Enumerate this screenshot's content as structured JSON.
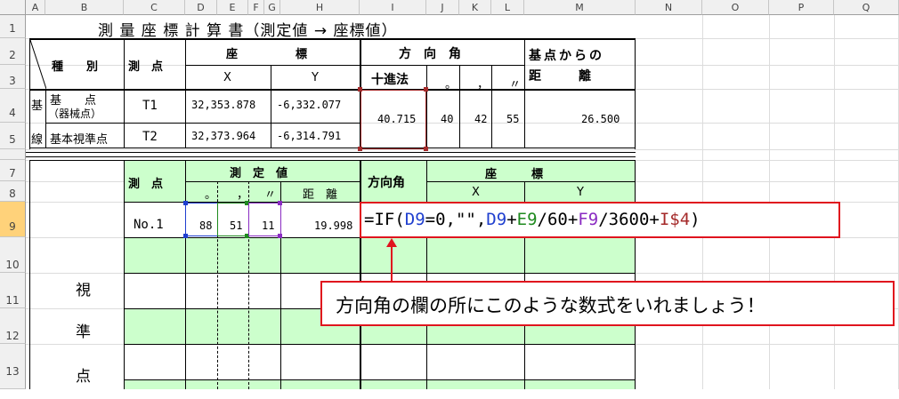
{
  "columns": [
    "A",
    "B",
    "C",
    "D",
    "E",
    "F",
    "G",
    "H",
    "I",
    "J",
    "K",
    "L",
    "M",
    "N",
    "O",
    "P",
    "Q"
  ],
  "rows": [
    "1",
    "2",
    "3",
    "4",
    "5",
    "",
    "7",
    "8",
    "9",
    "10",
    "11",
    "12",
    "13"
  ],
  "title": "測 量 座 標 計 算 書（測定値 → 座標値）",
  "header": {
    "kind": "種　　別",
    "station": "測　点",
    "coord": "座　　　　　標",
    "x": "X",
    "y": "Y",
    "direction": "方　向　角",
    "decimal": "十進法",
    "deg": "。",
    "min": "，",
    "sec": "〃",
    "dist_head1": "基点からの",
    "dist_head2": "距　　　離"
  },
  "base": {
    "side1": "基",
    "side2": "線",
    "row1_kind1": "基　　点",
    "row1_kind2": "（器械点）",
    "row1_station": "T1",
    "row1_x": "32,353.878",
    "row1_y": "-6,332.077",
    "row2_kind": "基本視準点",
    "row2_station": "T2",
    "row2_x": "32,373.964",
    "row2_y": "-6,314.791",
    "decimal_value": "40.715",
    "deg": "40",
    "min": "42",
    "sec": "55",
    "distance": "26.500"
  },
  "obs_header": {
    "station": "測　点",
    "measured": "測　定　値",
    "deg": "。",
    "min": "，",
    "sec": "〃",
    "distance": "距　離",
    "direction": "方向角",
    "coord": "座　　　標",
    "x": "X",
    "y": "Y"
  },
  "side_label": [
    "視",
    "準",
    "点"
  ],
  "obs_row": {
    "station": "No.1",
    "deg": "88",
    "min": "51",
    "sec": "11",
    "distance": "19.998"
  },
  "formula": {
    "parts": [
      {
        "text": "=IF(",
        "color": "#000000"
      },
      {
        "text": "D9",
        "color": "#1f3fcf"
      },
      {
        "text": "=0,\"\",",
        "color": "#000000"
      },
      {
        "text": "D9",
        "color": "#1f3fcf"
      },
      {
        "text": "+",
        "color": "#000000"
      },
      {
        "text": "E9",
        "color": "#1e8a1e"
      },
      {
        "text": "/60+",
        "color": "#000000"
      },
      {
        "text": "F9",
        "color": "#8a2bc2"
      },
      {
        "text": "/3600+",
        "color": "#000000"
      },
      {
        "text": "I$4",
        "color": "#a52a2a"
      },
      {
        "text": ")",
        "color": "#000000"
      }
    ]
  },
  "callout": "方向角の欄の所にこのような数式をいれましょう！",
  "colors": {
    "green_fill": "#ccffcc",
    "callout_border": "#e0141e",
    "selection_cyan": "#4fd4ff",
    "ref_blue": "#1f3fcf",
    "ref_green": "#1e8a1e",
    "ref_purple": "#8a2bc2",
    "ref_brown": "#a52a2a"
  }
}
